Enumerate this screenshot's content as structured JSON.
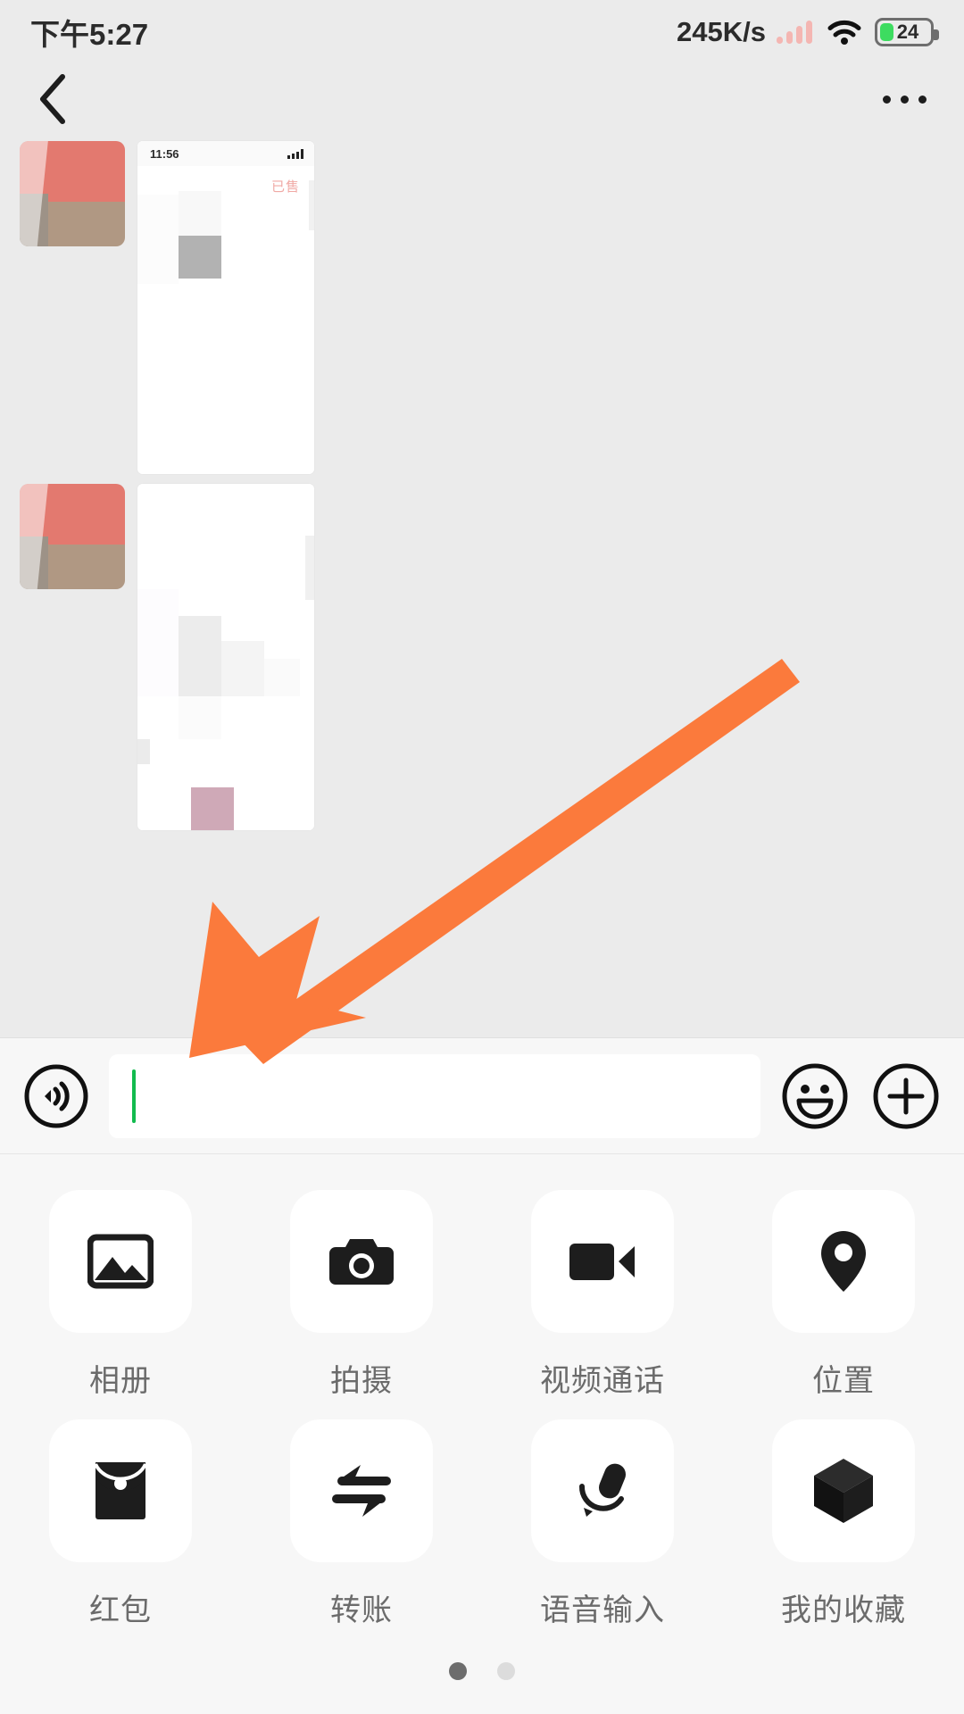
{
  "status_bar": {
    "time": "下午5:27",
    "network_speed": "245K/s",
    "battery_level": "24",
    "signal_icon": "signal-bars-icon",
    "wifi_icon": "wifi-icon",
    "battery_icon": "battery-icon",
    "accent_signal_color": "#f4b6b2",
    "battery_fill_color": "#3ddc60"
  },
  "nav_bar": {
    "back_icon": "chevron-left-icon",
    "title": "",
    "more_icon": "more-options-icon"
  },
  "chat": {
    "messages": [
      {
        "sender_avatar": "contact-avatar",
        "content_type": "image-screenshot",
        "screenshot_time": "11:56",
        "screenshot_tag": "已售"
      },
      {
        "sender_avatar": "contact-avatar",
        "content_type": "image-screenshot",
        "screenshot_time": "",
        "screenshot_tag": ""
      }
    ]
  },
  "input_bar": {
    "voice_icon": "voice-input-icon",
    "input_value": "",
    "input_placeholder": "",
    "emoji_icon": "emoji-smiley-icon",
    "plus_icon": "plus-circle-icon",
    "cursor_color": "#12bb4e"
  },
  "attachment_panel": {
    "items": [
      {
        "label": "相册",
        "icon": "photo-album-icon"
      },
      {
        "label": "拍摄",
        "icon": "camera-icon"
      },
      {
        "label": "视频通话",
        "icon": "video-call-icon"
      },
      {
        "label": "位置",
        "icon": "location-pin-icon"
      },
      {
        "label": "红包",
        "icon": "red-packet-icon"
      },
      {
        "label": "转账",
        "icon": "transfer-money-icon"
      },
      {
        "label": "语音输入",
        "icon": "microphone-icon"
      },
      {
        "label": "我的收藏",
        "icon": "favorites-cube-icon"
      }
    ],
    "page_dots": {
      "count": 2,
      "active_index": 0
    }
  },
  "annotation": {
    "arrow_icon": "pointer-arrow-icon",
    "arrow_color": "#fb7a3c",
    "points_to": "相册"
  }
}
